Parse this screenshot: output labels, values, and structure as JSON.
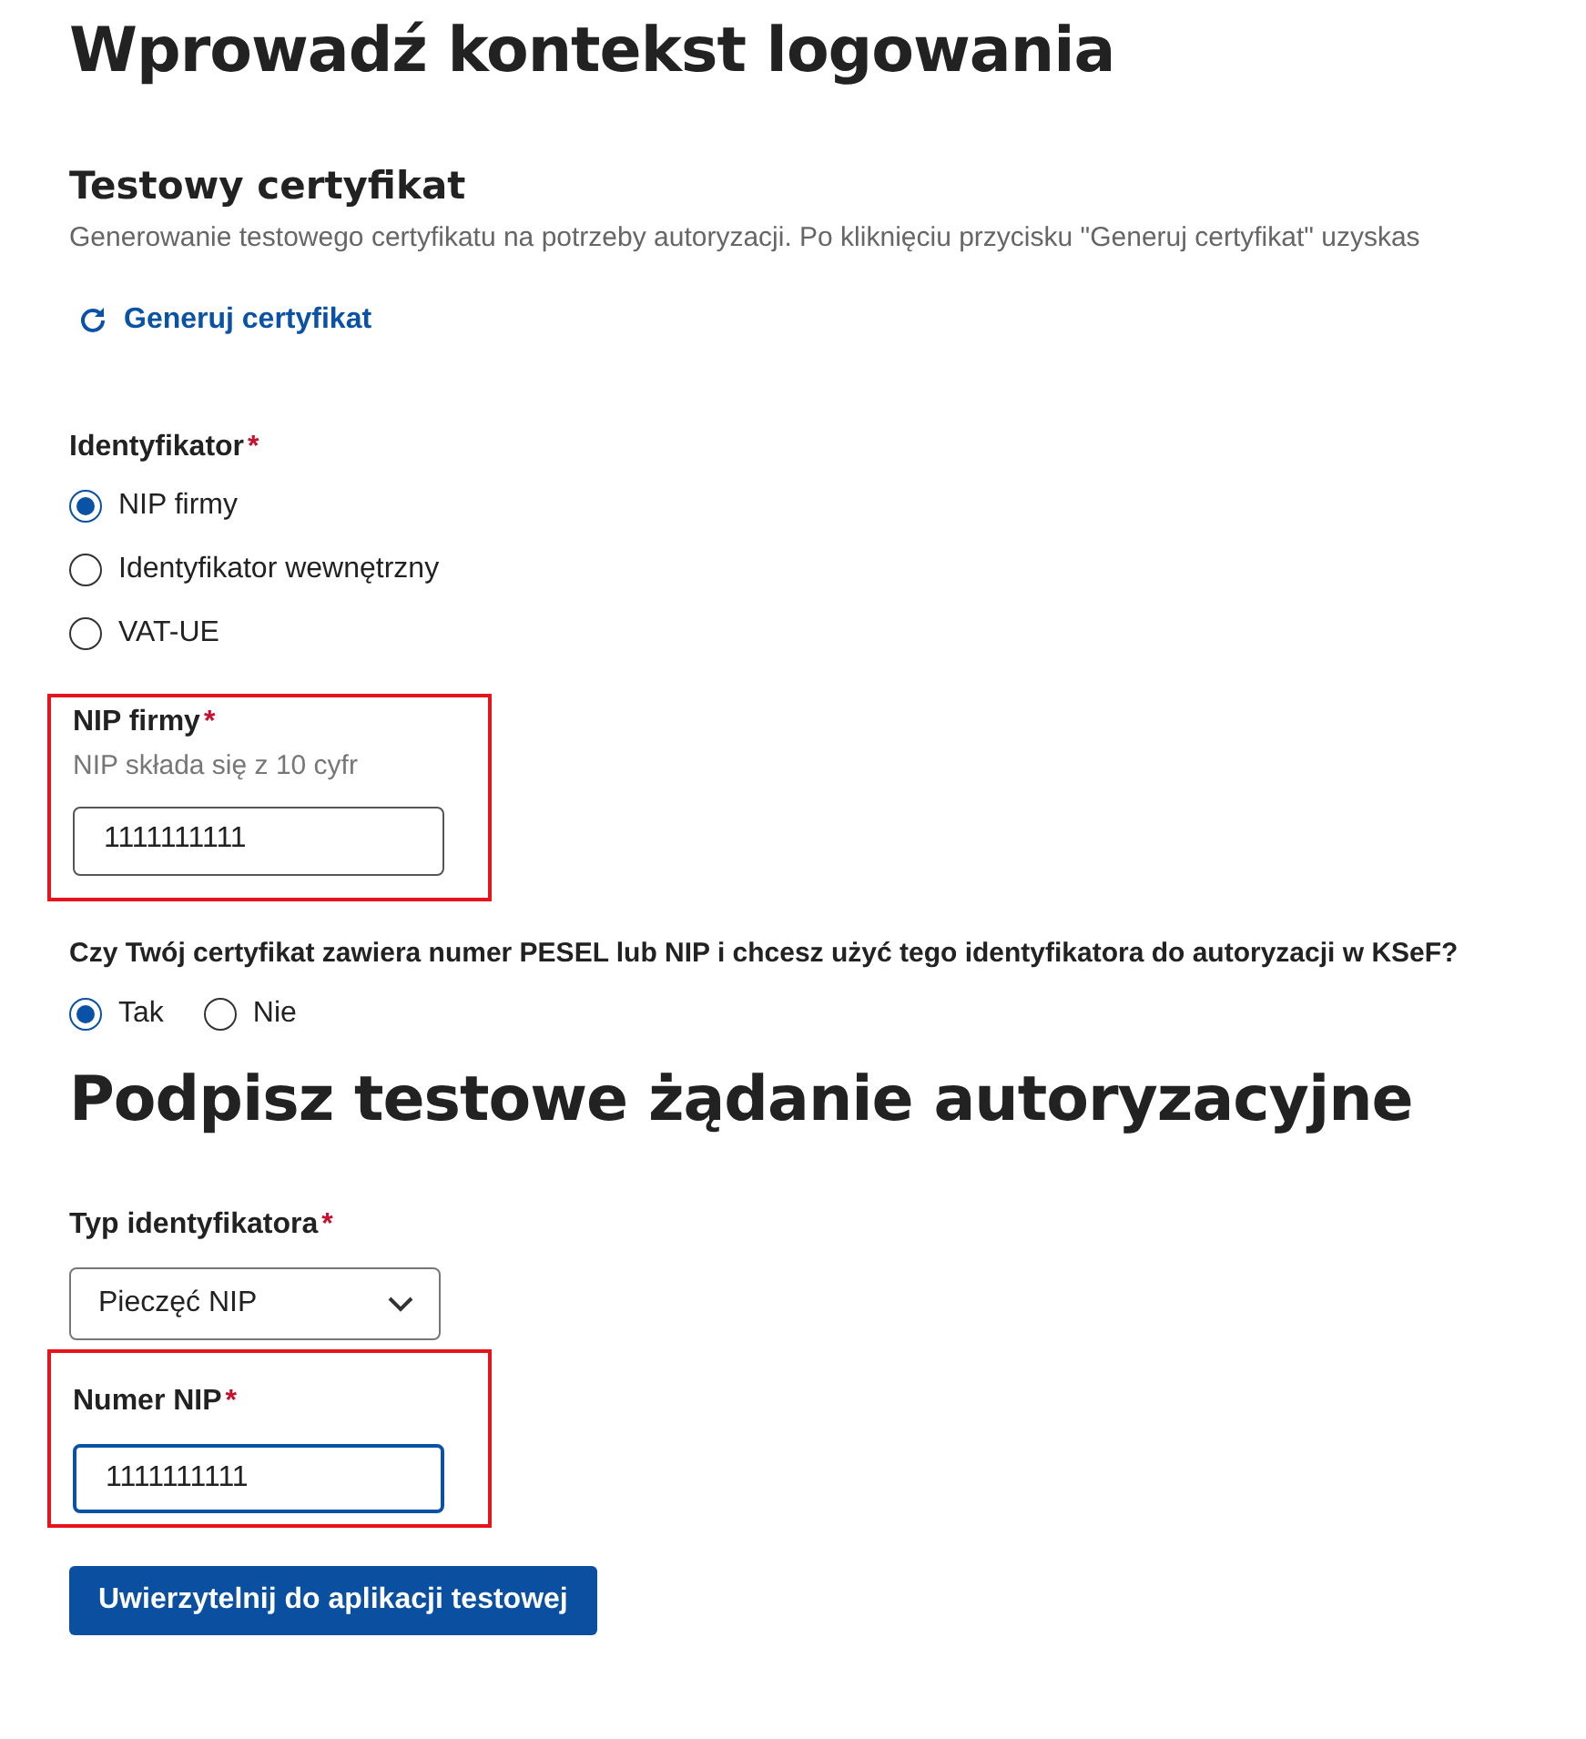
{
  "title": "Wprowadź kontekst logowania",
  "certificate": {
    "heading": "Testowy certyfikat",
    "description": "Generowanie testowego certyfikatu na potrzeby autoryzacji. Po kliknięciu przycisku \"Generuj certyfikat\" uzyskas",
    "action": "Generuj certyfikat"
  },
  "identifier": {
    "label": "Identyfikator",
    "required_mark": "*",
    "options": [
      {
        "label": "NIP firmy",
        "selected": true
      },
      {
        "label": "Identyfikator wewnętrzny",
        "selected": false
      },
      {
        "label": "VAT-UE",
        "selected": false
      }
    ]
  },
  "nip_field": {
    "label": "NIP firmy",
    "required_mark": "*",
    "hint": "NIP składa się z 10 cyfr",
    "value": "1111111111",
    "highlighted": true,
    "focused": false
  },
  "question": {
    "label": "Czy Twój certyfikat zawiera numer PESEL lub NIP i chcesz użyć tego identyfikatora do autoryzacji w KSeF?",
    "options": [
      {
        "label": "Tak",
        "selected": true
      },
      {
        "label": "Nie",
        "selected": false
      }
    ]
  },
  "sign": {
    "heading": "Podpisz testowe żądanie autoryzacyjne",
    "type_field": {
      "label": "Typ identyfikatora",
      "required_mark": "*",
      "value": "Pieczęć NIP"
    },
    "number_field": {
      "label": "Numer NIP",
      "required_mark": "*",
      "value": "1111111111",
      "highlighted": true,
      "focused": true
    },
    "submit": "Uwierzytelnij do aplikacji testowej"
  }
}
